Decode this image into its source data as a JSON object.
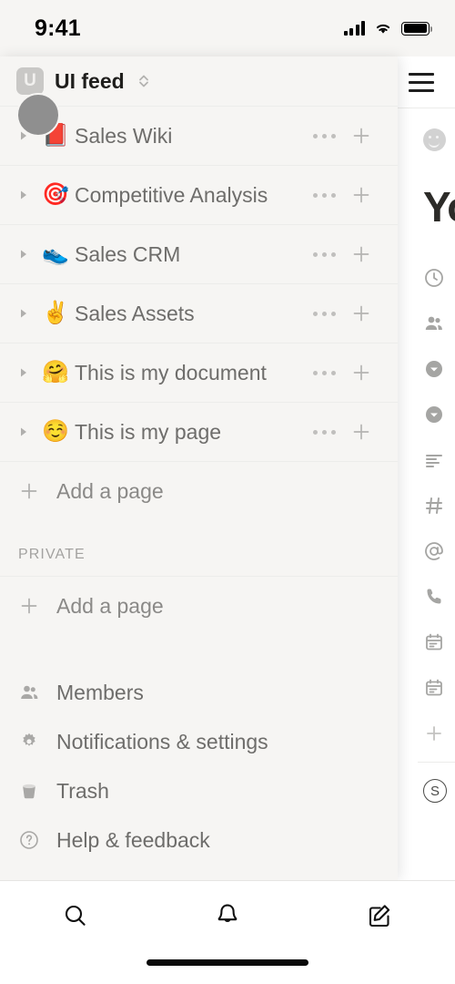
{
  "status_bar": {
    "time": "9:41",
    "cellular_icon": "signal-bars-icon",
    "wifi_icon": "wifi-icon",
    "battery_icon": "battery-icon"
  },
  "workspace": {
    "badge_letter": "U",
    "name": "UI feed",
    "switcher_icon": "chevron-updown-icon",
    "avatar": "user-avatar"
  },
  "pages": [
    {
      "label": "Sales Wiki",
      "emoji": "📕",
      "emoji_name": "closed-book-emoji",
      "expand_icon": "triangle-right-icon",
      "more_icon": "more-options-icon",
      "add_icon": "plus-icon"
    },
    {
      "label": "Competitive Analysis",
      "emoji": "🎯",
      "emoji_name": "dart-emoji",
      "expand_icon": "triangle-right-icon",
      "more_icon": "more-options-icon",
      "add_icon": "plus-icon"
    },
    {
      "label": "Sales CRM",
      "emoji": "👟",
      "emoji_name": "running-shoe-emoji",
      "expand_icon": "triangle-right-icon",
      "more_icon": "more-options-icon",
      "add_icon": "plus-icon"
    },
    {
      "label": "Sales Assets",
      "emoji": "✌️",
      "emoji_name": "victory-hand-emoji",
      "expand_icon": "triangle-right-icon",
      "more_icon": "more-options-icon",
      "add_icon": "plus-icon"
    },
    {
      "label": "This is my document",
      "emoji": "🤗",
      "emoji_name": "hugging-face-emoji",
      "expand_icon": "triangle-right-icon",
      "more_icon": "more-options-icon",
      "add_icon": "plus-icon"
    },
    {
      "label": "This is my page",
      "emoji": "☺️",
      "emoji_name": "relieved-face-emoji",
      "expand_icon": "triangle-right-icon",
      "more_icon": "more-options-icon",
      "add_icon": "plus-icon"
    }
  ],
  "add_page_shared": {
    "label": "Add a page",
    "icon": "plus-icon"
  },
  "private_section": {
    "header": "PRIVATE",
    "add_page": {
      "label": "Add a page",
      "icon": "plus-icon"
    }
  },
  "menu": [
    {
      "label": "Members",
      "icon": "members-icon"
    },
    {
      "label": "Notifications & settings",
      "icon": "gear-icon"
    },
    {
      "label": "Trash",
      "icon": "trash-icon"
    },
    {
      "label": "Help & feedback",
      "icon": "help-circle-icon"
    }
  ],
  "page_panel": {
    "menu_icon": "hamburger-menu-icon",
    "page_emoji_icon": "smiley-face-icon",
    "title": "Yo",
    "block_icons": [
      "clock-icon",
      "people-icon",
      "chevron-down-circle-icon",
      "chevron-down-circle-icon",
      "text-lines-icon",
      "hash-icon",
      "at-sign-icon",
      "phone-icon",
      "calendar-icon",
      "calendar-icon",
      "plus-icon"
    ],
    "footer_badge": "S"
  },
  "tab_bar": [
    {
      "icon": "search-icon",
      "name": "search-tab"
    },
    {
      "icon": "bell-icon",
      "name": "notifications-tab"
    },
    {
      "icon": "compose-icon",
      "name": "compose-tab"
    }
  ],
  "colors": {
    "sidebar_bg": "#f6f5f3",
    "panel_bg": "#ffffff",
    "text_primary": "#1f1e1c",
    "text_secondary": "#6e6d6b",
    "text_muted": "#a3a2a0",
    "divider": "#ececea",
    "avatar": "#8f8f8f"
  }
}
